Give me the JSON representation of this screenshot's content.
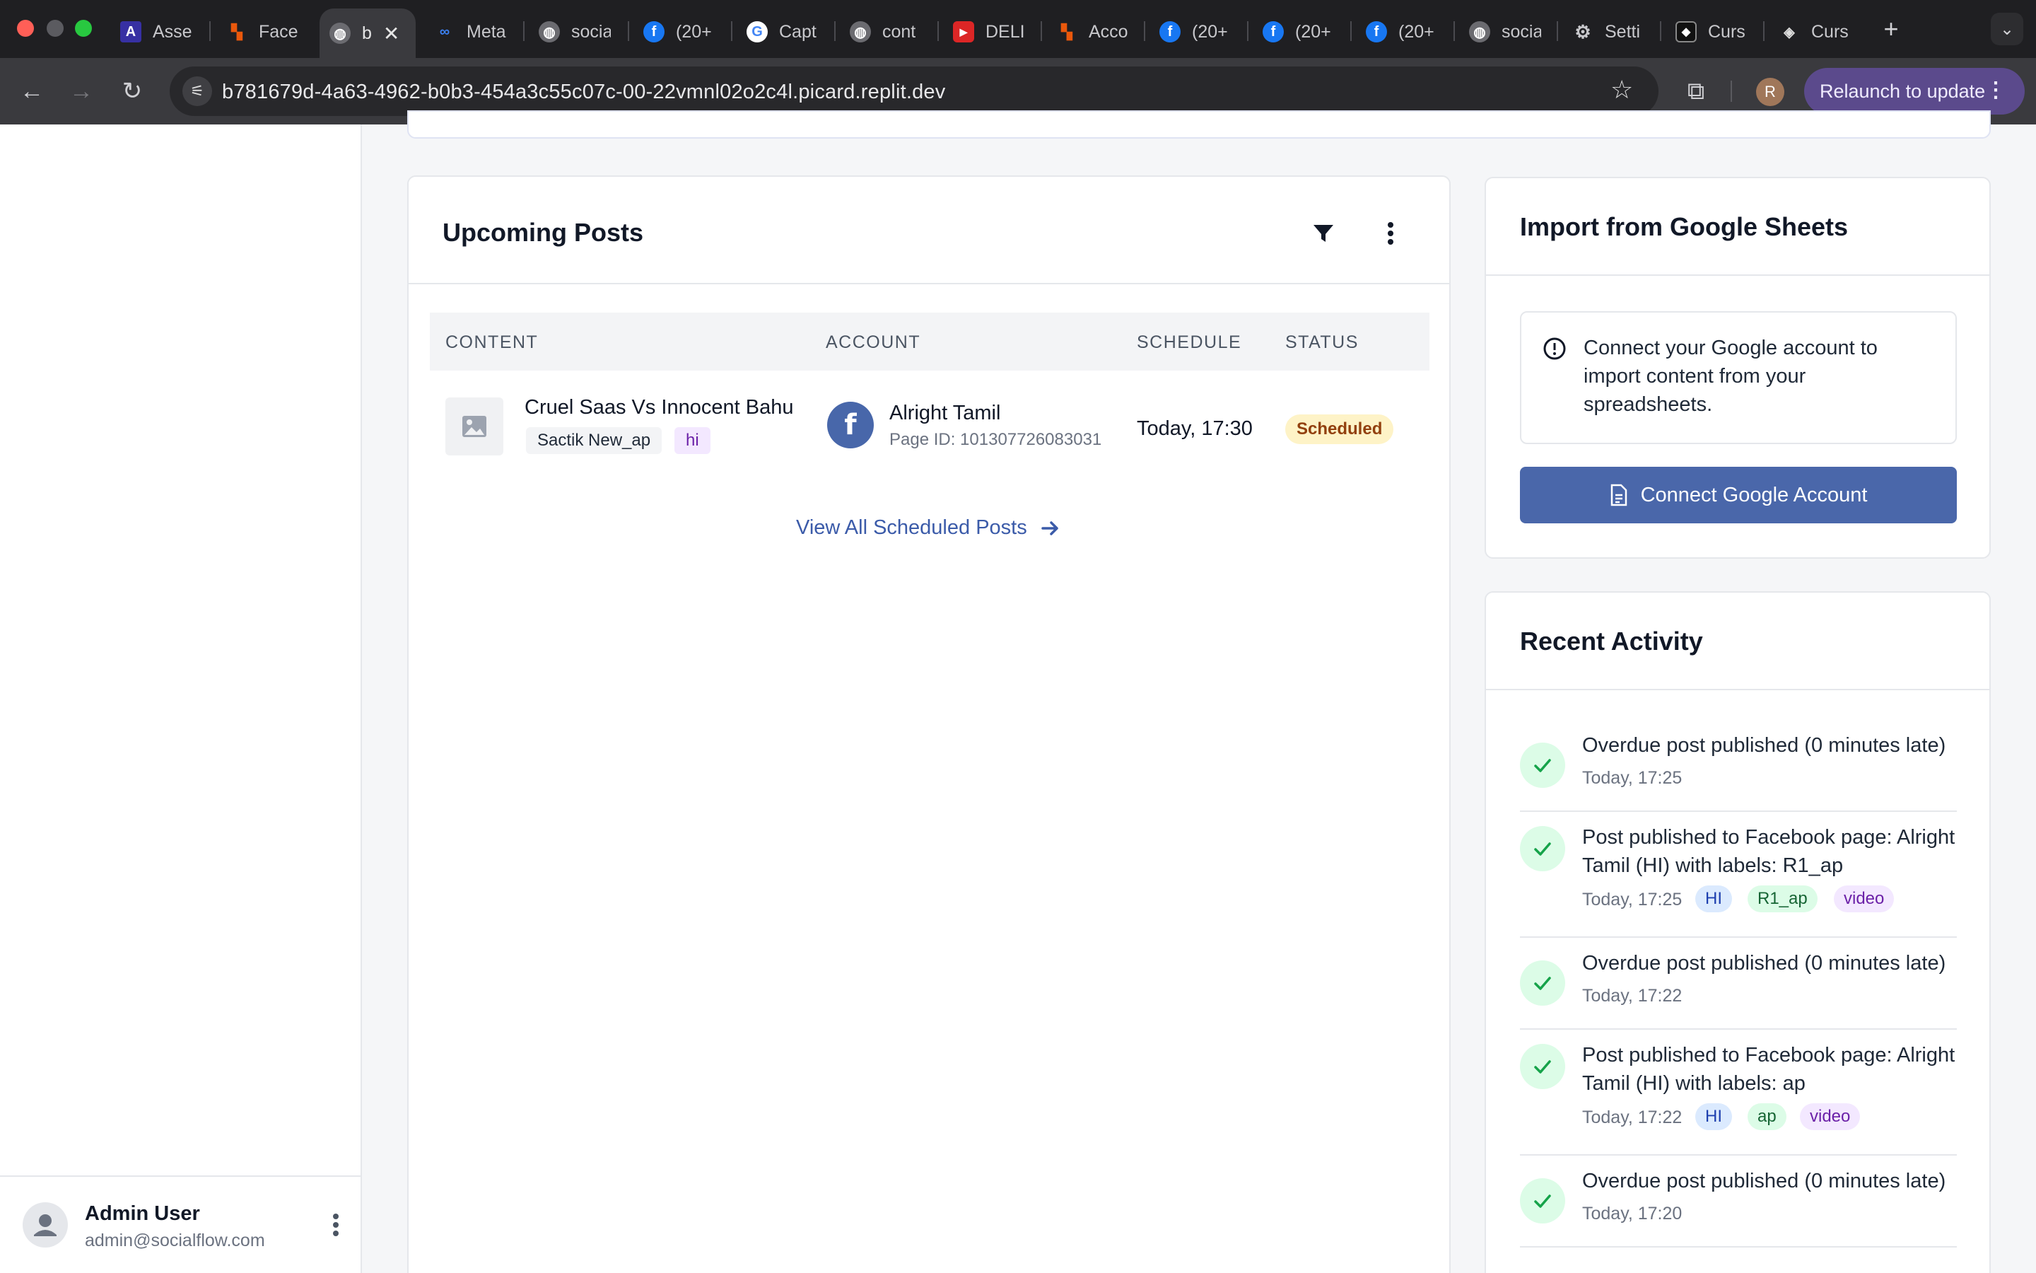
{
  "browser": {
    "tabs": [
      {
        "label": "Asse",
        "icon": "asana-icon",
        "color": "#4f46e5"
      },
      {
        "label": "Face",
        "icon": "bars-icon",
        "color": "#ea580c"
      },
      {
        "label": "b",
        "icon": "globe-icon",
        "color": "#9ca3af"
      },
      {
        "label": "Meta",
        "icon": "meta-icon",
        "color": "#2563eb"
      },
      {
        "label": "socia",
        "icon": "globe-icon",
        "color": "#9ca3af"
      },
      {
        "label": "(20+",
        "icon": "facebook-icon",
        "color": "#1877f2"
      },
      {
        "label": "Capt",
        "icon": "google-icon",
        "color": "#ffffff"
      },
      {
        "label": "cont",
        "icon": "globe-icon",
        "color": "#9ca3af"
      },
      {
        "label": "DELI",
        "icon": "youtube-icon",
        "color": "#dc2626"
      },
      {
        "label": "Acco",
        "icon": "bars-icon",
        "color": "#ea580c"
      },
      {
        "label": "(20+",
        "icon": "facebook-icon",
        "color": "#1877f2"
      },
      {
        "label": "(20+",
        "icon": "facebook-icon",
        "color": "#1877f2"
      },
      {
        "label": "(20+",
        "icon": "facebook-icon",
        "color": "#1877f2"
      },
      {
        "label": "socia",
        "icon": "globe-icon",
        "color": "#9ca3af"
      },
      {
        "label": "Setti",
        "icon": "gear-icon",
        "color": "#9ca3af"
      },
      {
        "label": "Curs",
        "icon": "cursor-icon",
        "color": "#ffffff"
      },
      {
        "label": "Curs",
        "icon": "cursor-icon",
        "color": "#ffffff"
      }
    ],
    "url": "b781679d-4a63-4962-b0b3-454a3c55c07c-00-22vmnl02o2c4l.picard.replit.dev",
    "profile_initial": "R",
    "relaunch_label": "Relaunch to update"
  },
  "sidebar": {
    "user": {
      "name": "Admin User",
      "email": "admin@socialflow.com"
    }
  },
  "upcoming": {
    "title": "Upcoming Posts",
    "columns": [
      "CONTENT",
      "ACCOUNT",
      "SCHEDULE",
      "STATUS"
    ],
    "rows": [
      {
        "title": "Cruel Saas Vs Innocent Bahu",
        "tags": [
          "Sactik New_ap",
          "hi"
        ],
        "account_name": "Alright Tamil",
        "account_id": "Page ID: 101307726083031",
        "schedule": "Today, 17:30",
        "status": "Scheduled"
      }
    ],
    "view_all": "View All Scheduled Posts"
  },
  "sheets": {
    "title": "Import from Google Sheets",
    "info": "Connect your Google account to import content from your spreadsheets.",
    "button": "Connect Google Account"
  },
  "activity": {
    "title": "Recent Activity",
    "items": [
      {
        "text": "Overdue post published (0 minutes late)",
        "time": "Today, 17:25",
        "chips": []
      },
      {
        "text": "Post published to Facebook page: Alright Tamil (HI) with labels: R1_ap",
        "time": "Today, 17:25",
        "chips": [
          "HI",
          "R1_ap",
          "video"
        ]
      },
      {
        "text": "Overdue post published (0 minutes late)",
        "time": "Today, 17:22",
        "chips": []
      },
      {
        "text": "Post published to Facebook page: Alright Tamil (HI) with labels: ap",
        "time": "Today, 17:22",
        "chips": [
          "HI",
          "ap",
          "video"
        ]
      },
      {
        "text": "Overdue post published (0 minutes late)",
        "time": "Today, 17:20",
        "chips": []
      }
    ]
  },
  "colors": {
    "primary": "#4a67aa",
    "link": "#3b5ba9",
    "success_bg": "#dcfce7",
    "success": "#16a34a",
    "scheduled_bg": "#fef3c7"
  }
}
